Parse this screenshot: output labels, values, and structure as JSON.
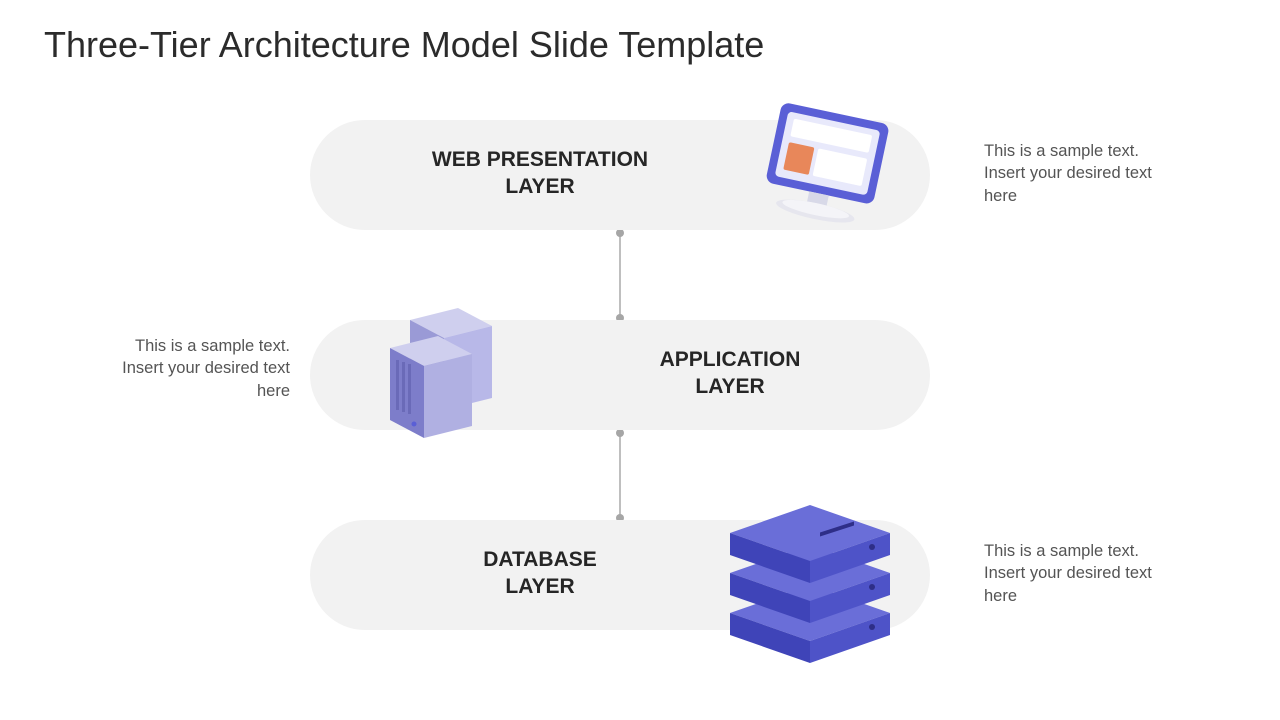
{
  "title": "Three-Tier Architecture Model Slide Template",
  "tiers": [
    {
      "label_line1": "WEB PRESENTATION",
      "label_line2": "LAYER",
      "caption": "This is a sample text. Insert your desired text here",
      "icon": "monitor-icon"
    },
    {
      "label_line1": "APPLICATION",
      "label_line2": "LAYER",
      "caption": "This is a sample text. Insert your desired text here",
      "icon": "servers-icon"
    },
    {
      "label_line1": "DATABASE",
      "label_line2": "LAYER",
      "caption": "This is a sample text. Insert your desired text here",
      "icon": "database-stack-icon"
    }
  ],
  "colors": {
    "pill": "#f2f2f2",
    "accent": "#5a5fd6",
    "accent_dark": "#3a3fb0",
    "accent_light": "#b6b8ee"
  }
}
